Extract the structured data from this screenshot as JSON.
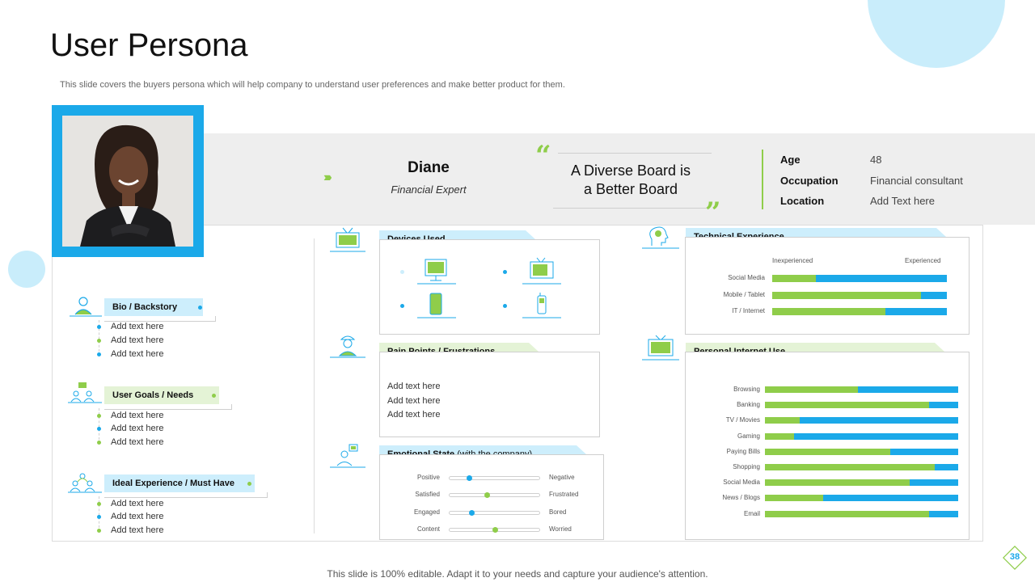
{
  "title": "User Persona",
  "subtitle": "This slide covers the buyers persona which will help company to understand user preferences and make better product for them.",
  "persona": {
    "name": "Diane",
    "role": "Financial Expert",
    "quote_line1": "A Diverse Board is",
    "quote_line2": "a Better Board",
    "info": [
      {
        "key": "Age",
        "value": "48"
      },
      {
        "key": "Occupation",
        "value": "Financial consultant"
      },
      {
        "key": "Location",
        "value": "Add Text here"
      }
    ]
  },
  "left_sections": [
    {
      "label": "Bio / Backstory",
      "items": [
        "Add text here",
        "Add text here",
        "Add text here"
      ]
    },
    {
      "label": "User Goals / Needs",
      "items": [
        "Add text here",
        "Add text here",
        "Add text here"
      ]
    },
    {
      "label": "Ideal Experience / Must Have",
      "items": [
        "Add text here",
        "Add text here",
        "Add text here"
      ]
    }
  ],
  "devices": {
    "label": "Devices Used"
  },
  "pain_points": {
    "label": "Pain Points / Frustrations",
    "items": [
      "Add text here",
      "Add text here",
      "Add text here"
    ]
  },
  "emotional_state": {
    "label": "Emotional State",
    "label_note": "(with the company)",
    "rows": [
      {
        "left": "Positive",
        "right": "Negative",
        "level": 0.22
      },
      {
        "left": "Satisfied",
        "right": "Frustrated",
        "level": 0.42
      },
      {
        "left": "Engaged",
        "right": "Bored",
        "level": 0.25
      },
      {
        "left": "Content",
        "right": "Worried",
        "level": 0.5
      }
    ]
  },
  "technical_experience": {
    "label": "Technical Experience",
    "scale_low": "Inexperienced",
    "scale_high": "Experienced",
    "rows": [
      {
        "label": "Social Media",
        "value": 0.25
      },
      {
        "label": "Mobile / Tablet",
        "value": 0.85
      },
      {
        "label": "IT / Internet",
        "value": 0.65
      }
    ]
  },
  "internet_use": {
    "label": "Personal Internet Use",
    "rows": [
      {
        "label": "Browsing",
        "value": 0.48
      },
      {
        "label": "Banking",
        "value": 0.85
      },
      {
        "label": "TV  / Movies",
        "value": 0.18
      },
      {
        "label": "Gaming",
        "value": 0.15
      },
      {
        "label": "Paying Bills",
        "value": 0.65
      },
      {
        "label": "Shopping",
        "value": 0.88
      },
      {
        "label": "Social Media",
        "value": 0.75
      },
      {
        "label": "News / Blogs",
        "value": 0.3
      },
      {
        "label": "Email",
        "value": 0.85
      }
    ]
  },
  "colors": {
    "accent_blue": "#1ba9e9",
    "accent_green": "#8fcd4a",
    "light_blue": "#cdeefc",
    "light_green": "#e4f3d6"
  },
  "page_number": "38",
  "footer": "This slide is 100% editable. Adapt it to your needs and capture your audience's attention."
}
